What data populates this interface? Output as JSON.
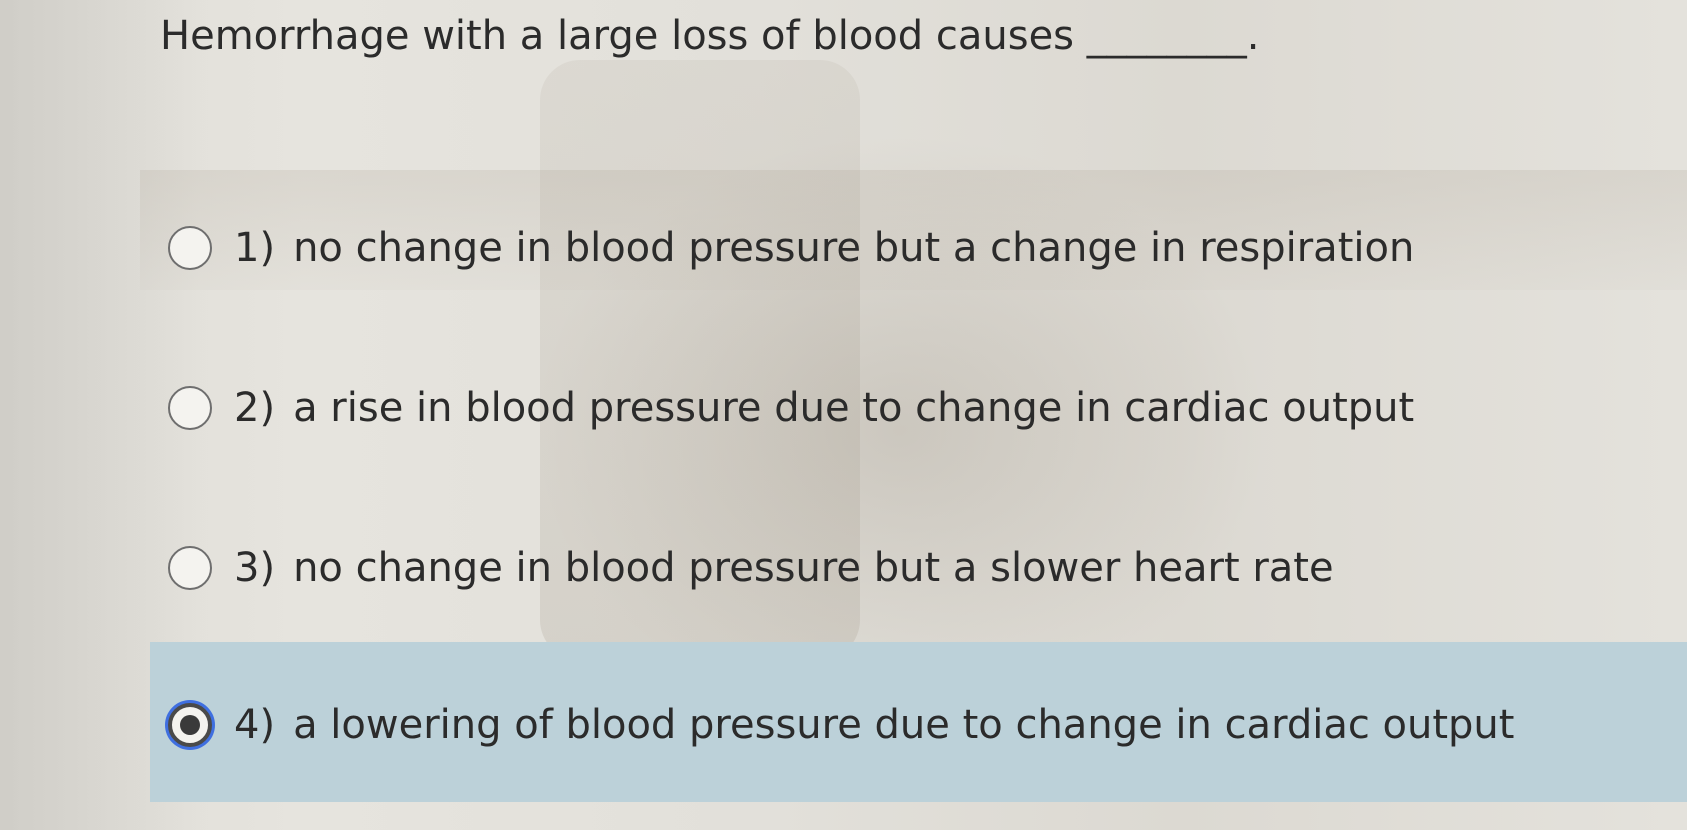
{
  "question": {
    "text": "Hemorrhage with a large loss of blood causes ________."
  },
  "options": [
    {
      "number": "1)",
      "text": "no change in blood pressure but a change in respiration",
      "selected": false
    },
    {
      "number": "2)",
      "text": "a rise in blood pressure due to change in cardiac output",
      "selected": false
    },
    {
      "number": "3)",
      "text": "no change in blood pressure but a slower heart rate",
      "selected": false
    },
    {
      "number": "4)",
      "text": "a lowering of blood pressure due to change in cardiac output",
      "selected": true
    }
  ],
  "colors": {
    "selected_background": "#bcd1d9",
    "focus_ring": "#3f6fe0"
  },
  "icons": {
    "unselected": "radio-unselected-icon",
    "selected": "radio-selected-icon"
  }
}
